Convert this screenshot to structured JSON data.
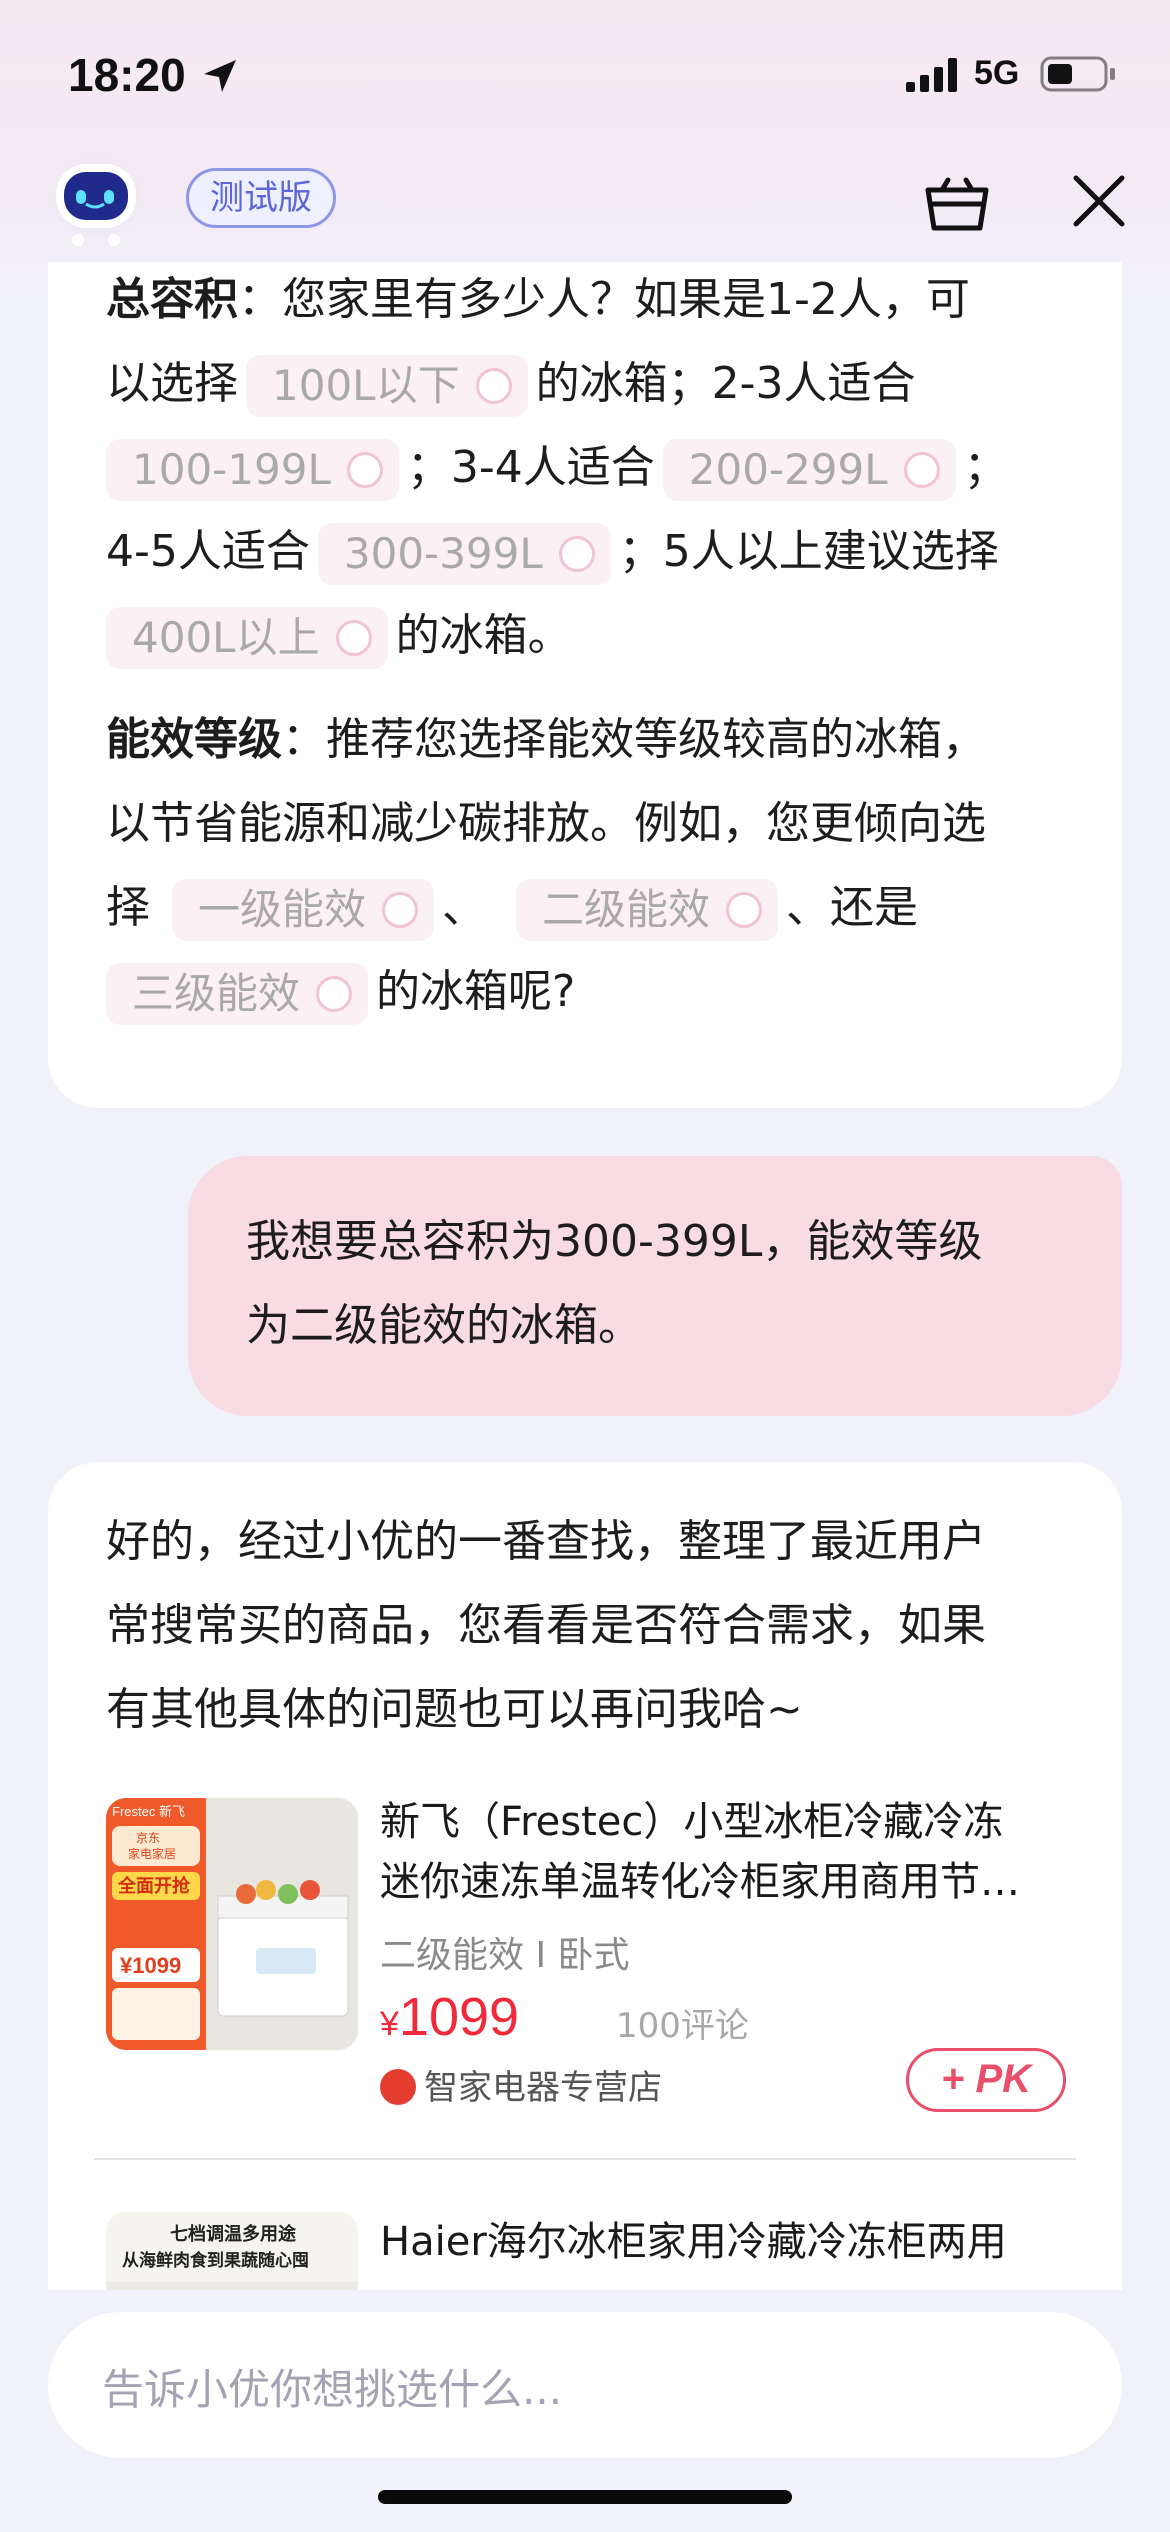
{
  "status_bar": {
    "time": "18:20",
    "network": "5G"
  },
  "header": {
    "badge": "测试版"
  },
  "card1": {
    "capacity_heading": "总容积",
    "cap_line1": "：您家里有多少人？如果是1-2人，可",
    "cap_line2_a": "以选择",
    "cap_line2_b": "的冰箱；2-3人适合",
    "cap_line3_b": "；3-4人适合",
    "cap_line3_c": "；",
    "cap_line4_a": "4-5人适合",
    "cap_line4_b": "；5人以上建议选择",
    "cap_line5_b": "的冰箱。",
    "capacity_options": [
      "100L以下",
      "100-199L",
      "200-299L",
      "300-399L",
      "400L以上"
    ],
    "energy_heading": "能效等级",
    "en_line1": "：推荐您选择能效等级较高的冰箱，",
    "en_line2": "以节省能源和减少碳排放。例如，您更倾向选",
    "en_line3_a": "择",
    "en_line3_b": "、",
    "en_line3_c": "、还是",
    "en_line4_b": "的冰箱呢?",
    "energy_options": [
      "一级能效",
      "二级能效",
      "三级能效"
    ]
  },
  "user_message": {
    "line1": "我想要总容积为300-399L，能效等级",
    "line2": "为二级能效的冰箱。"
  },
  "card2": {
    "intro_line1": "好的，经过小优的一番查找，整理了最近用户",
    "intro_line2": "常搜常买的商品，您看看是否符合需求，如果",
    "intro_line3": "有其他具体的问题也可以再问我哈~",
    "products": [
      {
        "title_line1": "新飞（Frestec）小型冰柜冷藏冷冻",
        "title_line2": "迷你速冻单温转化冷柜家用商用节…",
        "subtitle": "二级能效 I 卧式",
        "currency": "¥",
        "price": "1099",
        "reviews": "100评论",
        "shop": "智家电器专营店",
        "pk_label": "+ PK",
        "img_text": [
          "Frestec 新飞",
          "京东",
          "家电家居",
          "全面开抢",
          "¥1099"
        ]
      },
      {
        "title_line1": "Haier海尔冰柜家用冷藏冷冻柜两用",
        "img_text": [
          "七档调温多用途",
          "从海鲜肉食到果蔬随心囤"
        ]
      }
    ]
  },
  "input": {
    "placeholder": "告诉小优你想挑选什么..."
  }
}
